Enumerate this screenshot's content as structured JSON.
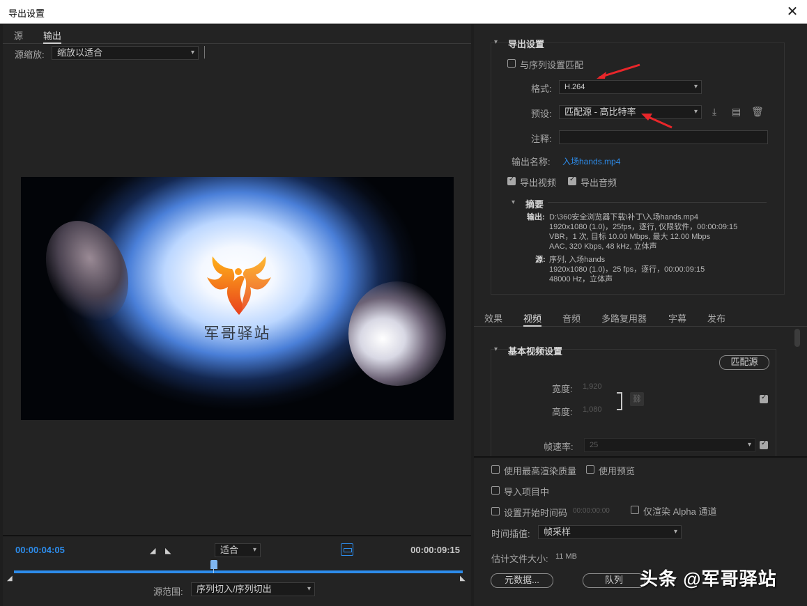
{
  "window": {
    "title": "导出设置",
    "close": "✕"
  },
  "left": {
    "tabs": [
      "源",
      "输出"
    ],
    "source_zoom_label": "源缩放:",
    "source_zoom_value": "缩放以适合",
    "preview_brand_text": "军哥驿站",
    "timeline": {
      "current_tc": "00:00:04:05",
      "end_tc": "00:00:09:15",
      "fit_value": "适合",
      "source_range_label": "源范围:",
      "source_range_value": "序列切入/序列切出",
      "playhead_progress": 0.445
    }
  },
  "export": {
    "section_title": "导出设置",
    "match_sequence_label": "与序列设置匹配",
    "match_sequence_checked": false,
    "format_label": "格式:",
    "format_value": "H.264",
    "preset_label": "预设:",
    "preset_value": "匹配源 - 高比特率",
    "comment_label": "注释:",
    "comment_value": "",
    "output_name_label": "输出名称:",
    "output_name_value": "入场hands.mp4",
    "export_video_label": "导出视频",
    "export_video_checked": true,
    "export_audio_label": "导出音频",
    "export_audio_checked": true,
    "summary_title": "摘要",
    "summary_output_label": "输出:",
    "summary_output_lines": [
      "D:\\360安全浏览器下载\\补丁\\入场hands.mp4",
      "1920x1080 (1.0)，25fps，逐行, 仅限软件，00:00:09:15",
      "VBR，1 次, 目标 10.00 Mbps, 最大 12.00 Mbps",
      "AAC, 320 Kbps, 48  kHz, 立体声"
    ],
    "summary_source_label": "源:",
    "summary_source_lines": [
      "序列, 入场hands",
      "1920x1080 (1.0)，25 fps，逐行，00:00:09:15",
      "48000 Hz，立体声"
    ]
  },
  "settings_tabs": [
    "效果",
    "视频",
    "音频",
    "多路复用器",
    "字幕",
    "发布"
  ],
  "basic_video": {
    "section_title": "基本视频设置",
    "match_source_button": "匹配源",
    "width_label": "宽度:",
    "width_value": "1,920",
    "height_label": "高度:",
    "height_value": "1,080",
    "frame_rate_label": "帧速率:",
    "frame_rate_value": "25"
  },
  "bottom": {
    "max_render_label": "使用最高渲染质量",
    "use_preview_label": "使用预览",
    "import_project_label": "导入项目中",
    "set_start_tc_label": "设置开始时间码",
    "start_tc_value": "00:00:00:00",
    "alpha_only_label": "仅渲染 Alpha 通道",
    "time_interp_label": "时间插值:",
    "time_interp_value": "帧采样",
    "file_size_label": "估计文件大小:",
    "file_size_value": "11 MB",
    "metadata_button": "元数据...",
    "queue_button": "队列"
  },
  "watermark": "头条 @军哥驿站",
  "colors": {
    "accent": "#2d8ceb",
    "bg": "#232323",
    "arrow": "#e8262a"
  }
}
